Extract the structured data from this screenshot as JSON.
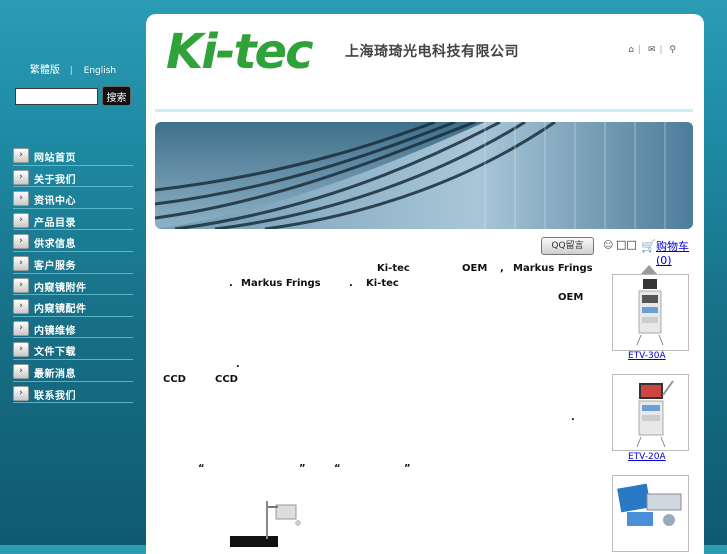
{
  "sidebar": {
    "lang_traditional": "繁體版",
    "lang_separator": "|",
    "lang_english": "English",
    "search_placeholder": "",
    "search_button": "搜索",
    "menu": [
      {
        "label": "网站首页"
      },
      {
        "label": "关于我们"
      },
      {
        "label": "资讯中心"
      },
      {
        "label": "产品目录"
      },
      {
        "label": "供求信息"
      },
      {
        "label": "客户服务"
      },
      {
        "label": "内窥镜附件"
      },
      {
        "label": "内窥镜配件"
      },
      {
        "label": "内镜维修"
      },
      {
        "label": "文件下载"
      },
      {
        "label": "最新消息"
      },
      {
        "label": "联系我们"
      }
    ]
  },
  "header": {
    "logo": "Ki-tec",
    "company_name": "上海琦琦光电科技有限公司",
    "icons": [
      "home-icon",
      "mail-icon",
      "sitemap-icon"
    ]
  },
  "toolbar": {
    "qq_button": "QQ留言",
    "user_boxes": "□□",
    "cart_link": "购物车 (0)"
  },
  "content": {
    "t1": "Ki-tec",
    "t2": "OEM",
    "t3": ",",
    "t4": "Markus Frings",
    "t5": ".",
    "t6": "Markus Frings",
    "t7": ".",
    "t8": "Ki-tec",
    "t9": "OEM",
    "t10": ".",
    "t11": "CCD",
    "t12": "CCD",
    "t13": ".",
    "t14": "“",
    "t15": "”",
    "t16": "“",
    "t17": "”"
  },
  "products": [
    {
      "label": "ETV-30A"
    },
    {
      "label": "ETV-20A"
    },
    {
      "label": ""
    }
  ],
  "colors": {
    "sidebar_bg": "#1f8aa3",
    "logo_green": "#2fa33a",
    "link_blue": "#0000cc"
  }
}
